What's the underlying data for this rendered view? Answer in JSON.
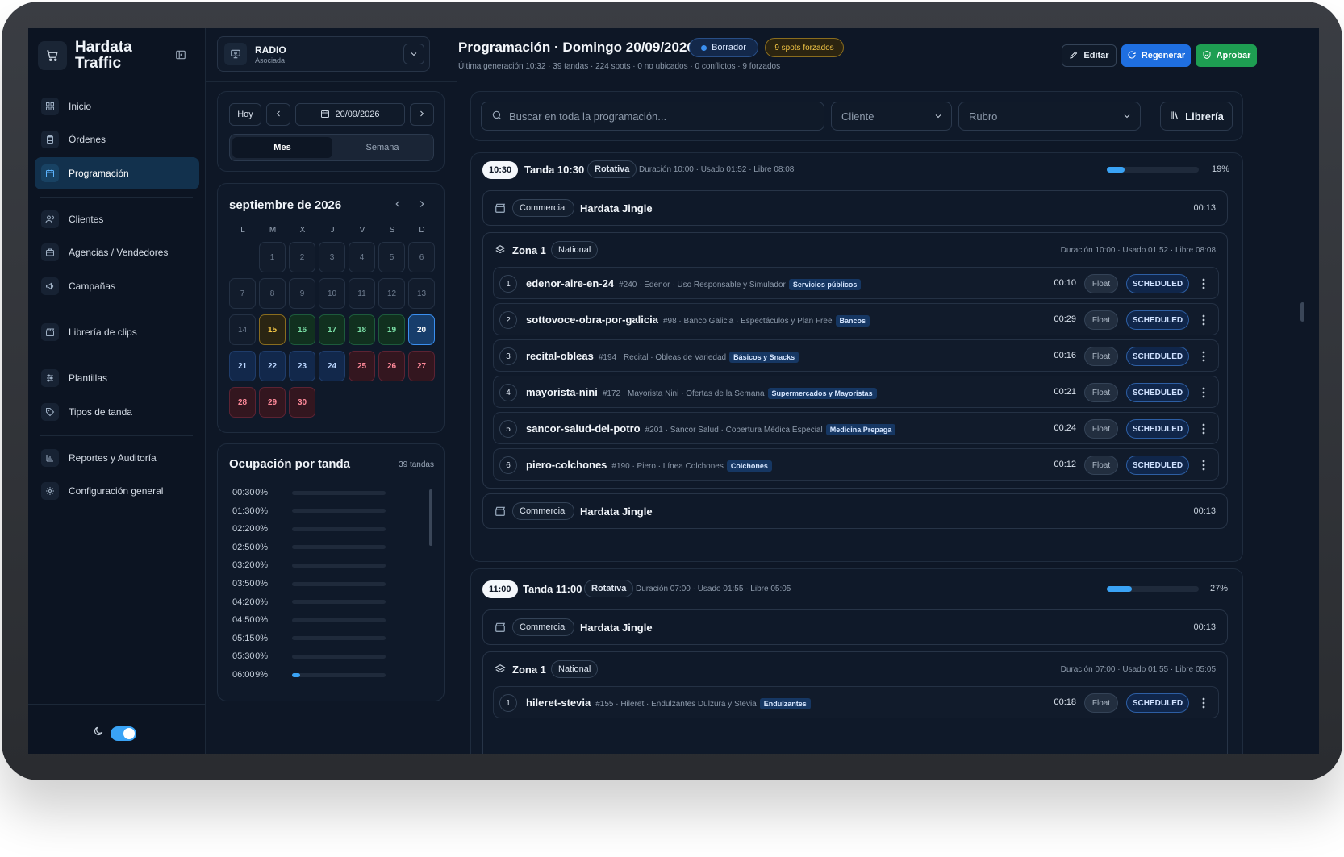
{
  "app": {
    "name": "Hardata Traffic"
  },
  "nav": [
    {
      "label": "Inicio",
      "icon": "home-grid-icon"
    },
    {
      "label": "Órdenes",
      "icon": "clipboard-icon"
    },
    {
      "label": "Programación",
      "icon": "calendar-icon",
      "active": true
    },
    {
      "label": "Clientes",
      "icon": "users-icon"
    },
    {
      "label": "Agencias / Vendedores",
      "icon": "briefcase-icon"
    },
    {
      "label": "Campañas",
      "icon": "megaphone-icon"
    },
    {
      "label": "Librería de clips",
      "icon": "clapperboard-icon"
    },
    {
      "label": "Plantillas",
      "icon": "sliders-icon"
    },
    {
      "label": "Tipos de tanda",
      "icon": "tag-icon"
    },
    {
      "label": "Reportes y Auditoría",
      "icon": "bar-chart-icon"
    },
    {
      "label": "Configuración general",
      "icon": "gear-icon"
    }
  ],
  "theme": {
    "dark_mode": true
  },
  "station": {
    "name": "RADIO",
    "subtitle": "Asociada"
  },
  "date_nav": {
    "today_label": "Hoy",
    "date": "20/09/2026",
    "views": [
      "Mes",
      "Semana"
    ],
    "active_view": "Mes"
  },
  "calendar": {
    "title": "septiembre de 2026",
    "weekdays": [
      "L",
      "M",
      "X",
      "J",
      "V",
      "S",
      "D"
    ],
    "days": [
      {
        "d": "1",
        "s": ""
      },
      {
        "d": "2",
        "s": ""
      },
      {
        "d": "3",
        "s": ""
      },
      {
        "d": "4",
        "s": ""
      },
      {
        "d": "5",
        "s": ""
      },
      {
        "d": "6",
        "s": ""
      },
      {
        "d": "7",
        "s": ""
      },
      {
        "d": "8",
        "s": ""
      },
      {
        "d": "9",
        "s": ""
      },
      {
        "d": "10",
        "s": ""
      },
      {
        "d": "11",
        "s": ""
      },
      {
        "d": "12",
        "s": ""
      },
      {
        "d": "13",
        "s": ""
      },
      {
        "d": "14",
        "s": ""
      },
      {
        "d": "15",
        "s": "y"
      },
      {
        "d": "16",
        "s": "g"
      },
      {
        "d": "17",
        "s": "g"
      },
      {
        "d": "18",
        "s": "g"
      },
      {
        "d": "19",
        "s": "g"
      },
      {
        "d": "20",
        "s": "sel"
      },
      {
        "d": "21",
        "s": "b"
      },
      {
        "d": "22",
        "s": "b"
      },
      {
        "d": "23",
        "s": "b"
      },
      {
        "d": "24",
        "s": "b"
      },
      {
        "d": "25",
        "s": "r"
      },
      {
        "d": "26",
        "s": "r"
      },
      {
        "d": "27",
        "s": "r"
      },
      {
        "d": "28",
        "s": "r"
      },
      {
        "d": "29",
        "s": "r"
      },
      {
        "d": "30",
        "s": "r"
      }
    ]
  },
  "occupancy": {
    "title": "Ocupación por tanda",
    "count": "39 tandas",
    "rows": [
      {
        "time": "00:30",
        "pct": "0%",
        "value": 0
      },
      {
        "time": "01:30",
        "pct": "0%",
        "value": 0
      },
      {
        "time": "02:20",
        "pct": "0%",
        "value": 0
      },
      {
        "time": "02:50",
        "pct": "0%",
        "value": 0
      },
      {
        "time": "03:20",
        "pct": "0%",
        "value": 0
      },
      {
        "time": "03:50",
        "pct": "0%",
        "value": 0
      },
      {
        "time": "04:20",
        "pct": "0%",
        "value": 0
      },
      {
        "time": "04:50",
        "pct": "0%",
        "value": 0
      },
      {
        "time": "05:15",
        "pct": "0%",
        "value": 0
      },
      {
        "time": "05:30",
        "pct": "0%",
        "value": 0
      },
      {
        "time": "06:00",
        "pct": "9%",
        "value": 9
      }
    ]
  },
  "header": {
    "title": "Programación · Domingo 20/09/2026",
    "status": "Borrador",
    "forced": "9 spots forzados",
    "subtitle": "Última generación 10:32 · 39 tandas · 224 spots · 0 no ubicados · 0 conflictos · 9 forzados",
    "actions": {
      "edit": "Editar",
      "regen": "Regenerar",
      "approve": "Aprobar"
    }
  },
  "filters": {
    "search_placeholder": "Buscar en toda la programación...",
    "client": "Cliente",
    "rubro": "Rubro",
    "library": "Librería"
  },
  "tandas": [
    {
      "time": "10:30",
      "name": "Tanda 10:30",
      "type": "Rotativa",
      "meta": "Duración 10:00 · Usado 01:52 · Libre 08:08",
      "pct": "19%",
      "value": 19,
      "jingle_tag": "Commercial",
      "jingle": "Hardata Jingle",
      "jingle_dur": "00:13",
      "zone": "Zona 1",
      "zone_tag": "National",
      "zone_meta": "Duración 10:00 · Usado 01:52 · Libre 08:08",
      "spots": [
        {
          "n": "1",
          "name": "edenor-aire-en-24",
          "desc": "#240 · Edenor · Uso Responsable y Simulador",
          "cat": "Servicios públicos",
          "dur": "00:10",
          "mode": "Float",
          "status": "SCHEDULED"
        },
        {
          "n": "2",
          "name": "sottovoce-obra-por-galicia",
          "desc": "#98 · Banco Galicia · Espectáculos y Plan Free",
          "cat": "Bancos",
          "dur": "00:29",
          "mode": "Float",
          "status": "SCHEDULED"
        },
        {
          "n": "3",
          "name": "recital-obleas",
          "desc": "#194 · Recital · Obleas de Variedad",
          "cat": "Básicos y Snacks",
          "dur": "00:16",
          "mode": "Float",
          "status": "SCHEDULED"
        },
        {
          "n": "4",
          "name": "mayorista-nini",
          "desc": "#172 · Mayorista Nini · Ofertas de la Semana",
          "cat": "Supermercados y Mayoristas",
          "dur": "00:21",
          "mode": "Float",
          "status": "SCHEDULED"
        },
        {
          "n": "5",
          "name": "sancor-salud-del-potro",
          "desc": "#201 · Sancor Salud · Cobertura Médica Especial",
          "cat": "Medicina Prepaga",
          "dur": "00:24",
          "mode": "Float",
          "status": "SCHEDULED"
        },
        {
          "n": "6",
          "name": "piero-colchones",
          "desc": "#190 · Piero · Línea Colchones",
          "cat": "Colchones",
          "dur": "00:12",
          "mode": "Float",
          "status": "SCHEDULED"
        }
      ],
      "jingle_end_tag": "Commercial",
      "jingle_end": "Hardata Jingle",
      "jingle_end_dur": "00:13"
    },
    {
      "time": "11:00",
      "name": "Tanda 11:00",
      "type": "Rotativa",
      "meta": "Duración 07:00 · Usado 01:55 · Libre 05:05",
      "pct": "27%",
      "value": 27,
      "jingle_tag": "Commercial",
      "jingle": "Hardata Jingle",
      "jingle_dur": "00:13",
      "zone": "Zona 1",
      "zone_tag": "National",
      "zone_meta": "Duración 07:00 · Usado 01:55 · Libre 05:05",
      "spots": [
        {
          "n": "1",
          "name": "hileret-stevia",
          "desc": "#155 · Hileret · Endulzantes Dulzura y Stevia",
          "cat": "Endulzantes",
          "dur": "00:18",
          "mode": "Float",
          "status": "SCHEDULED"
        }
      ]
    }
  ]
}
